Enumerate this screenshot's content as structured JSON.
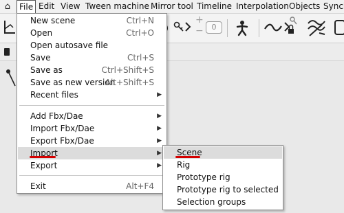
{
  "menubar": {
    "items": [
      "File",
      "Edit",
      "View",
      "Tween machine",
      "Mirror tool",
      "Timeline",
      "Interpolation",
      "Objects",
      "Synch"
    ]
  },
  "toolbar": {
    "counter_value": "0",
    "plus_label": "+",
    "minus_label": "−"
  },
  "file_menu": {
    "items": [
      {
        "label": "New scene",
        "shortcut": "Ctrl+N"
      },
      {
        "label": "Open",
        "shortcut": "Ctrl+O"
      },
      {
        "label": "Open autosave file",
        "shortcut": ""
      },
      {
        "label": "Save",
        "shortcut": "Ctrl+S"
      },
      {
        "label": "Save as",
        "shortcut": "Ctrl+Shift+S"
      },
      {
        "label": "Save as new version",
        "shortcut": "Alt+Shift+S"
      },
      {
        "label": "Recent files",
        "shortcut": ""
      },
      {
        "label": "Add Fbx/Dae",
        "shortcut": ""
      },
      {
        "label": "Import Fbx/Dae",
        "shortcut": ""
      },
      {
        "label": "Export Fbx/Dae",
        "shortcut": ""
      },
      {
        "label": "Import",
        "shortcut": ""
      },
      {
        "label": "Export",
        "shortcut": ""
      },
      {
        "label": "Exit",
        "shortcut": "Alt+F4"
      }
    ],
    "submenu_arrow": "▶"
  },
  "import_submenu": {
    "items": [
      "Scene",
      "Rig",
      "Prototype rig",
      "Prototype rig to selected",
      "Selection groups"
    ]
  },
  "colors": {
    "annotation_underline": "#d40000",
    "highlight": "#dcdcdc"
  }
}
